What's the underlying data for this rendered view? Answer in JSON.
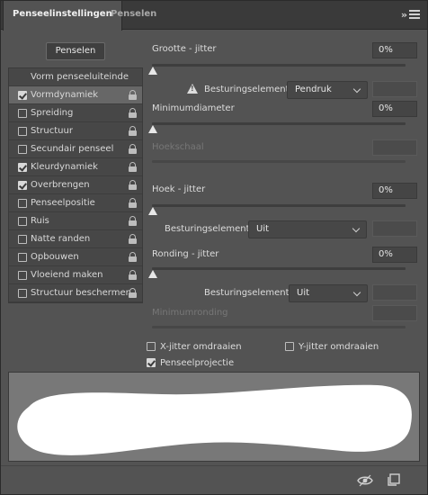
{
  "tabs": [
    {
      "label": "Penseelinstellingen",
      "active": true
    },
    {
      "label": "Penselen",
      "active": false
    }
  ],
  "header_icons": [
    "collapse-icon",
    "menu-icon"
  ],
  "brushes_button": "Penselen",
  "left_list": {
    "header": "Vorm penseeluiteinde",
    "items": [
      {
        "label": "Vormdynamiek",
        "checked": true,
        "selected": true
      },
      {
        "label": "Spreiding",
        "checked": false
      },
      {
        "label": "Structuur",
        "checked": false
      },
      {
        "label": "Secundair penseel",
        "checked": false
      },
      {
        "label": "Kleurdynamiek",
        "checked": true
      },
      {
        "label": "Overbrengen",
        "checked": true
      },
      {
        "label": "Penseelpositie",
        "checked": false
      },
      {
        "label": "Ruis",
        "checked": false
      },
      {
        "label": "Natte randen",
        "checked": false
      },
      {
        "label": "Opbouwen",
        "checked": false
      },
      {
        "label": "Vloeiend maken",
        "checked": false
      },
      {
        "label": "Structuur beschermen",
        "checked": false
      }
    ]
  },
  "settings": {
    "size_jitter": {
      "label": "Grootte - jitter",
      "value": "0%",
      "level": 0
    },
    "size_control": {
      "label": "Besturingselement:",
      "value": "Pendruk",
      "extra": ""
    },
    "min_diameter": {
      "label": "Minimumdiameter",
      "value": "0%",
      "level": 0
    },
    "tilt_scale": {
      "label": "Hoekschaal",
      "value": ""
    },
    "angle_jitter": {
      "label": "Hoek - jitter",
      "value": "0%",
      "level": 0
    },
    "angle_control": {
      "label": "Besturingselement:",
      "value": "Uit",
      "extra": ""
    },
    "roundness_jitter": {
      "label": "Ronding - jitter",
      "value": "0%",
      "level": 0
    },
    "roundness_control": {
      "label": "Besturingselement:",
      "value": "Uit",
      "extra": ""
    },
    "min_roundness": {
      "label": "Minimumronding",
      "value": ""
    }
  },
  "bottom_options": {
    "flip_x": {
      "label": "X-jitter omdraaien",
      "checked": false
    },
    "flip_y": {
      "label": "Y-jitter omdraaien",
      "checked": false
    },
    "brush_projection": {
      "label": "Penseelprojectie",
      "checked": true
    }
  },
  "footer_icons": [
    "eye-icon",
    "new-brush-icon"
  ],
  "colors": {
    "panel": "#535353",
    "tabbar": "#3a3a3a",
    "preview_bg": "#787878",
    "stroke": "#ffffff"
  }
}
